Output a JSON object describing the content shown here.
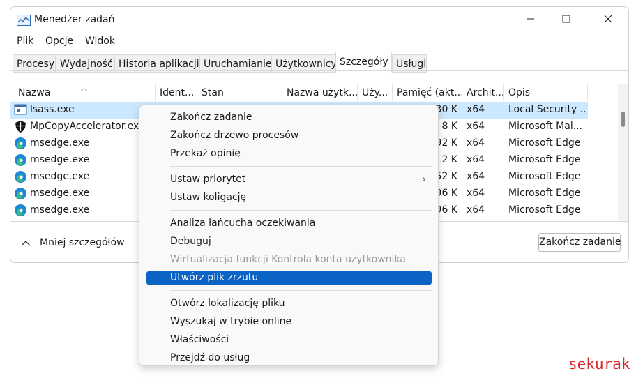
{
  "window": {
    "title": "Menedżer zadań",
    "app_icon": "task-manager-icon",
    "controls": [
      "minimize-icon",
      "maximize-icon",
      "close-icon"
    ]
  },
  "menubar": [
    "Plik",
    "Opcje",
    "Widok"
  ],
  "tabs": [
    {
      "label": "Procesy"
    },
    {
      "label": "Wydajność"
    },
    {
      "label": "Historia aplikacji"
    },
    {
      "label": "Uruchamianie"
    },
    {
      "label": "Użytkownicy"
    },
    {
      "label": "Szczegóły",
      "active": true
    },
    {
      "label": "Usługi"
    }
  ],
  "table": {
    "columns": [
      "Nazwa",
      "Ident...",
      "Stan",
      "Nazwa użytk...",
      "Uży...",
      "Pamięć (akt...",
      "Archit...",
      "Opis"
    ],
    "rows": [
      {
        "name": "lsass.exe",
        "memory": "30 K",
        "arch": "x64",
        "desc": "Local Security ...",
        "icon": "system-process-icon",
        "selected": true
      },
      {
        "name": "MpCopyAccelerator.exe",
        "memory": "8 K",
        "arch": "x64",
        "desc": "Microsoft Mal...",
        "icon": "defender-shield-icon"
      },
      {
        "name": "msedge.exe",
        "memory": "92 K",
        "arch": "x64",
        "desc": "Microsoft Edge",
        "icon": "edge-icon"
      },
      {
        "name": "msedge.exe",
        "memory": "12 K",
        "arch": "x64",
        "desc": "Microsoft Edge",
        "icon": "edge-icon"
      },
      {
        "name": "msedge.exe",
        "memory": "52 K",
        "arch": "x64",
        "desc": "Microsoft Edge",
        "icon": "edge-icon"
      },
      {
        "name": "msedge.exe",
        "memory": "96 K",
        "arch": "x64",
        "desc": "Microsoft Edge",
        "icon": "edge-icon"
      },
      {
        "name": "msedge.exe",
        "memory": "96 K",
        "arch": "x64",
        "desc": "Microsoft Edge",
        "icon": "edge-icon"
      }
    ]
  },
  "footer": {
    "fewer_details": "Mniej szczegółów",
    "end_task": "Zakończ zadanie"
  },
  "context_menu": {
    "items": [
      {
        "label": "Zakończ zadanie"
      },
      {
        "label": "Zakończ drzewo procesów"
      },
      {
        "label": "Przekaż opinię"
      },
      {
        "label": "Ustaw priorytet",
        "submenu": true
      },
      {
        "label": "Ustaw koligację"
      },
      {
        "label": "Analiza łańcucha oczekiwania"
      },
      {
        "label": "Debuguj"
      },
      {
        "label": "Wirtualizacja funkcji Kontrola konta użytkownika",
        "disabled": true
      },
      {
        "label": "Utwórz plik zrzutu",
        "highlighted": true
      },
      {
        "label": "Otwórz lokalizację pliku"
      },
      {
        "label": "Wyszukaj w trybie online"
      },
      {
        "label": "Właściwości"
      },
      {
        "label": "Przejdź do usług"
      }
    ]
  },
  "watermark": "sekurak",
  "colors": {
    "selection": "#cce8ff",
    "menu_highlight": "#0b63c4",
    "watermark": "#d7262a",
    "edge_blue": "#1e88d9",
    "edge_green": "#3cc46c"
  }
}
